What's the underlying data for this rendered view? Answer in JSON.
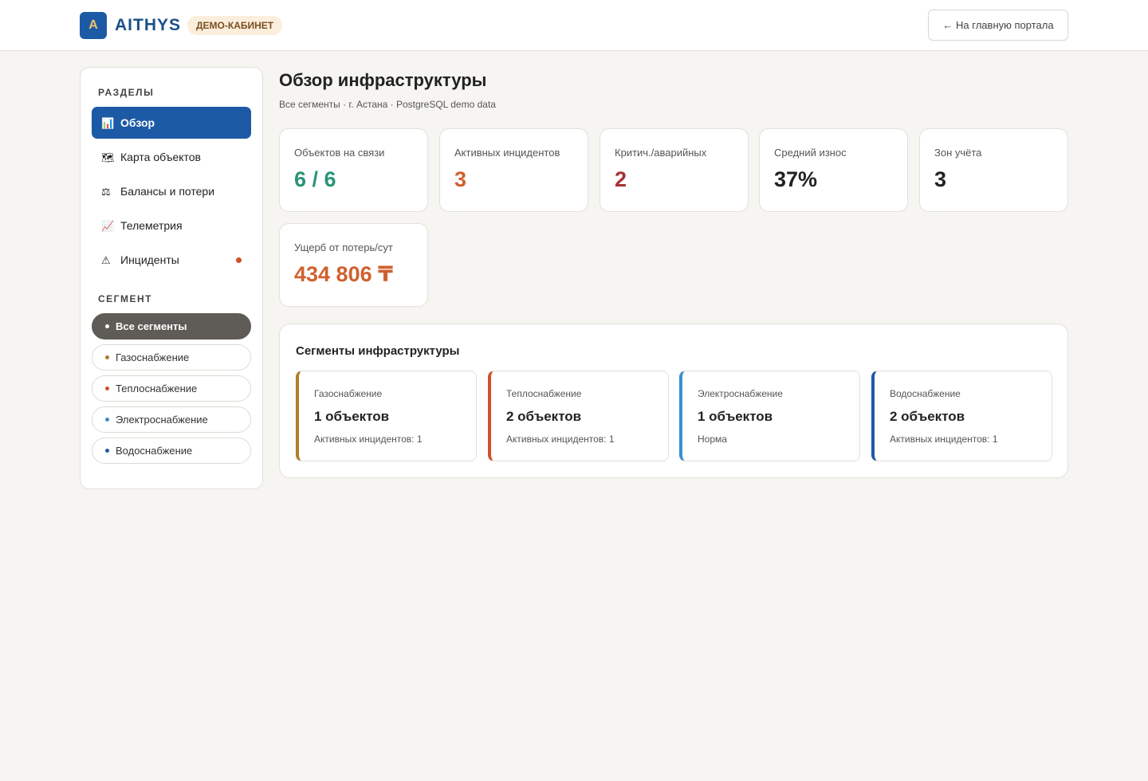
{
  "header": {
    "logo_letter": "A",
    "brand": "AITHYS",
    "badge": "ДЕМО-КАБИНЕТ",
    "portal_button": "← На главную портала"
  },
  "sidebar": {
    "sections_label": "РАЗДЕЛЫ",
    "nav": [
      {
        "icon": "📊",
        "label": "Обзор",
        "active": true
      },
      {
        "icon": "🗺",
        "label": "Карта объектов"
      },
      {
        "icon": "⚖",
        "label": "Балансы и потери"
      },
      {
        "icon": "📈",
        "label": "Телеметрия"
      },
      {
        "icon": "⚠",
        "label": "Инциденты",
        "has_alert": true
      }
    ],
    "segment_label": "СЕГМЕНТ",
    "segments": [
      {
        "label": "Все сегменты",
        "active": true,
        "color": "#ffffff"
      },
      {
        "label": "Газоснабжение",
        "color": "#b07d2b"
      },
      {
        "label": "Теплоснабжение",
        "color": "#d0502b"
      },
      {
        "label": "Электроснабжение",
        "color": "#3a8fd0"
      },
      {
        "label": "Водоснабжение",
        "color": "#1d5aa6"
      }
    ]
  },
  "main": {
    "title": "Обзор инфраструктуры",
    "subtitle": "Все сегменты · г. Астана · PostgreSQL demo data",
    "kpis": [
      {
        "label": "Объектов на связи",
        "value": "6 / 6",
        "color": "#2a9478"
      },
      {
        "label": "Активных инцидентов",
        "value": "3",
        "color": "#d0602f"
      },
      {
        "label": "Критич./аварийных",
        "value": "2",
        "color": "#a83232"
      },
      {
        "label": "Средний износ",
        "value": "37%",
        "color": "#222222"
      },
      {
        "label": "Зон учёта",
        "value": "3",
        "color": "#222222"
      },
      {
        "label": "Ущерб от потерь/сут",
        "value": "434 806 ₸",
        "color": "#d0602f"
      }
    ],
    "segments_panel": {
      "title": "Сегменты инфраструктуры",
      "cards": [
        {
          "name": "Газоснабжение",
          "count": "1 объектов",
          "status": "Активных инцидентов: 1",
          "color": "#b07d2b"
        },
        {
          "name": "Теплоснабжение",
          "count": "2 объектов",
          "status": "Активных инцидентов: 1",
          "color": "#d0502b"
        },
        {
          "name": "Электроснабжение",
          "count": "1 объектов",
          "status": "Норма",
          "color": "#3a8fd0"
        },
        {
          "name": "Водоснабжение",
          "count": "2 объектов",
          "status": "Активных инцидентов: 1",
          "color": "#1d5aa6"
        }
      ]
    }
  }
}
